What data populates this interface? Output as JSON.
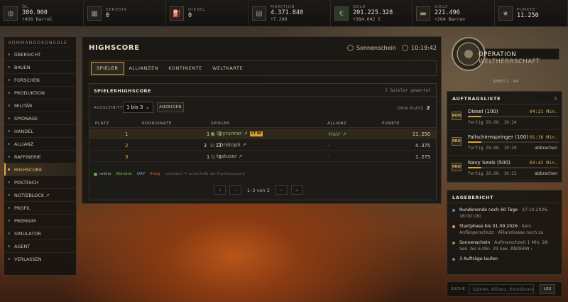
{
  "topbar": [
    {
      "label": "ÖL",
      "value": "380.900",
      "delta": "+456 Barrel",
      "icon": "barrel-icon"
    },
    {
      "label": "KEROSIN",
      "value": "0",
      "delta": "",
      "icon": "fuel-can-icon"
    },
    {
      "label": "DIESEL",
      "value": "0",
      "delta": "",
      "icon": "fuel-pump-icon"
    },
    {
      "label": "MUNITION",
      "value": "4.371.840",
      "delta": "+7.280",
      "icon": "ammo-icon"
    },
    {
      "label": "GELD",
      "value": "201.225.328",
      "delta": "+384.042 €",
      "icon": "money-icon"
    },
    {
      "label": "GOLD",
      "value": "221.496",
      "delta": "+264 Barren",
      "icon": "gold-bar-icon"
    },
    {
      "label": "PUNKTE",
      "value": "11.250",
      "delta": "",
      "icon": "trophy-icon"
    }
  ],
  "sidebar": {
    "heading": "KOMMANDOKONSOLE",
    "items": [
      "ÜBERSICHT",
      "BAUEN",
      "FORSCHEN",
      "PRODUKTION",
      "MILITÄR",
      "SPIONAGE",
      "HANDEL",
      "ALLIANZ",
      "RAFFINERIE",
      "HIGHSCORE",
      "POSTFACH",
      "NOTIZBLOCK ↗",
      "PROFIL",
      "PREMIUM",
      "SIMULATOR",
      "AGENT",
      "VERLASSEN"
    ]
  },
  "main": {
    "title": "HIGHSCORE",
    "weather": "Sonnenschein",
    "time": "10:19:42",
    "tabs": [
      "SPIELER",
      "ALLIANZEN",
      "KONTINENTE",
      "WELTKARTE"
    ],
    "box": {
      "heading": "SPIELERHIGHSCORE",
      "count": "3 Spieler gewertet",
      "section_label": "AUSSCHNITT",
      "section_value": "1 bis 3",
      "show_label": "ANZEIGEN",
      "my_place_label": "DEIN PLATZ",
      "my_place": "2",
      "columns": [
        "PLATZ",
        "KOORDINATE",
        "SPIELER",
        "ALLIANZ",
        "PUNKTE"
      ],
      "rows": [
        {
          "rank": "1",
          "coord": "1 : 1",
          "player": "Skyrunner ↗",
          "tag": "CT 00",
          "alliance": "-HaV- ↗",
          "points": "11.250"
        },
        {
          "rank": "2",
          "coord": "3 : 11",
          "player": "Christoph ↗",
          "tag": "",
          "alliance": "-",
          "points": "4.375"
        },
        {
          "rank": "3",
          "coord": "1 : 1",
          "player": "testuser ↗",
          "tag": "",
          "alliance": "-",
          "points": "1.275"
        }
      ],
      "legend": {
        "online": "online",
        "bund": "Bündnis",
        "nap": "NAP",
        "krieg": "Krieg",
        "note": "verblasst = außerhalb der Punktespanne"
      },
      "pager": "1–3 von 3"
    }
  },
  "logo": {
    "word1": "OPERATION",
    "word2": "WELTHERRSCHAFT",
    "speed": "SPEED 1 · V4"
  },
  "orders": {
    "heading": "AUFTRAGSLISTE",
    "count": "3",
    "items": [
      {
        "badge": "ROH",
        "name": "Diesel (100)",
        "time": "04:21 Min.",
        "done": "fertig 28.08. 10:24",
        "action": "",
        "progress": 0.15
      },
      {
        "badge": "PRO",
        "name": "Fallschirmspringer (100)",
        "time": "01:16 Min.",
        "done": "fertig 28.08. 10:20",
        "action": "abbrechen",
        "progress": 0.15
      },
      {
        "badge": "PRO",
        "name": "Navy Seals (500)",
        "time": "03:42 Min.",
        "done": "fertig 28.08. 10:23",
        "action": "abbrechen",
        "progress": 0.15
      }
    ]
  },
  "report": {
    "heading": "LAGEBERICHT",
    "items": [
      {
        "title": "Rundenende noch 60 Tage",
        "text": " · 27.10.2026, 16:00 Uhr",
        "color": "#4a8cc4"
      },
      {
        "title": "Startphase bis 01.09.2026",
        "text": " · Kein Anfängerschutz · Allianzkasse noch zu",
        "color": "#d9a232"
      },
      {
        "title": "Sonnenschein",
        "text": " · Aufmarschzeit 1 Min. 28 Sek. bis 6 Min. 29 Sek. ÄNDERN ›",
        "color": "#5fae4a"
      },
      {
        "title": "3 Aufträge laufen",
        "text": "",
        "color": "#4a8cc4"
      }
    ]
  },
  "search": {
    "label": "SUCHE",
    "placeholder": "Spieler, Allianz, Koordinate",
    "button": "LOS"
  }
}
